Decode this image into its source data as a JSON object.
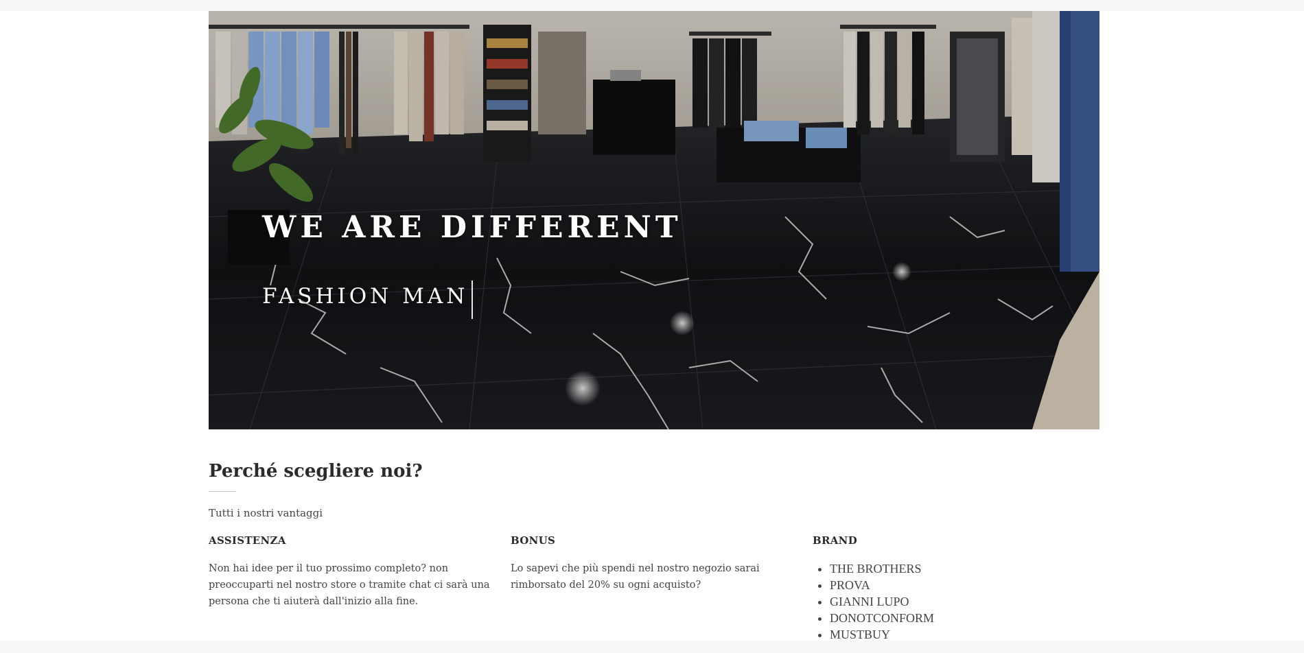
{
  "hero": {
    "title": "WE ARE DIFFERENT",
    "subtitle": "FASHION MAN"
  },
  "why_us": {
    "title": "Perché scegliere noi?",
    "subtitle": "Tutti i nostri vantaggi",
    "columns": [
      {
        "heading": "ASSISTENZA",
        "text": "Non hai idee per il tuo prossimo completo? non preoccuparti nel nostro store o tramite chat ci sarà una persona che ti aiuterà dall'inizio alla fine."
      },
      {
        "heading": "BONUS",
        "text": "Lo sapevi che più spendi nel nostro negozio sarai rimborsato del 20% su ogni acquisto?"
      },
      {
        "heading": "BRAND",
        "brands": [
          "THE BROTHERS",
          "PROVA",
          "GIANNI LUPO",
          "DONOTCONFORM",
          "MUSTBUY"
        ]
      }
    ]
  },
  "colors": {
    "page_background": "#ffffff",
    "strip_background": "#f7f7f7",
    "hero_text": "#ffffff",
    "heading_text": "#2b2b2b",
    "body_text": "#444444"
  }
}
